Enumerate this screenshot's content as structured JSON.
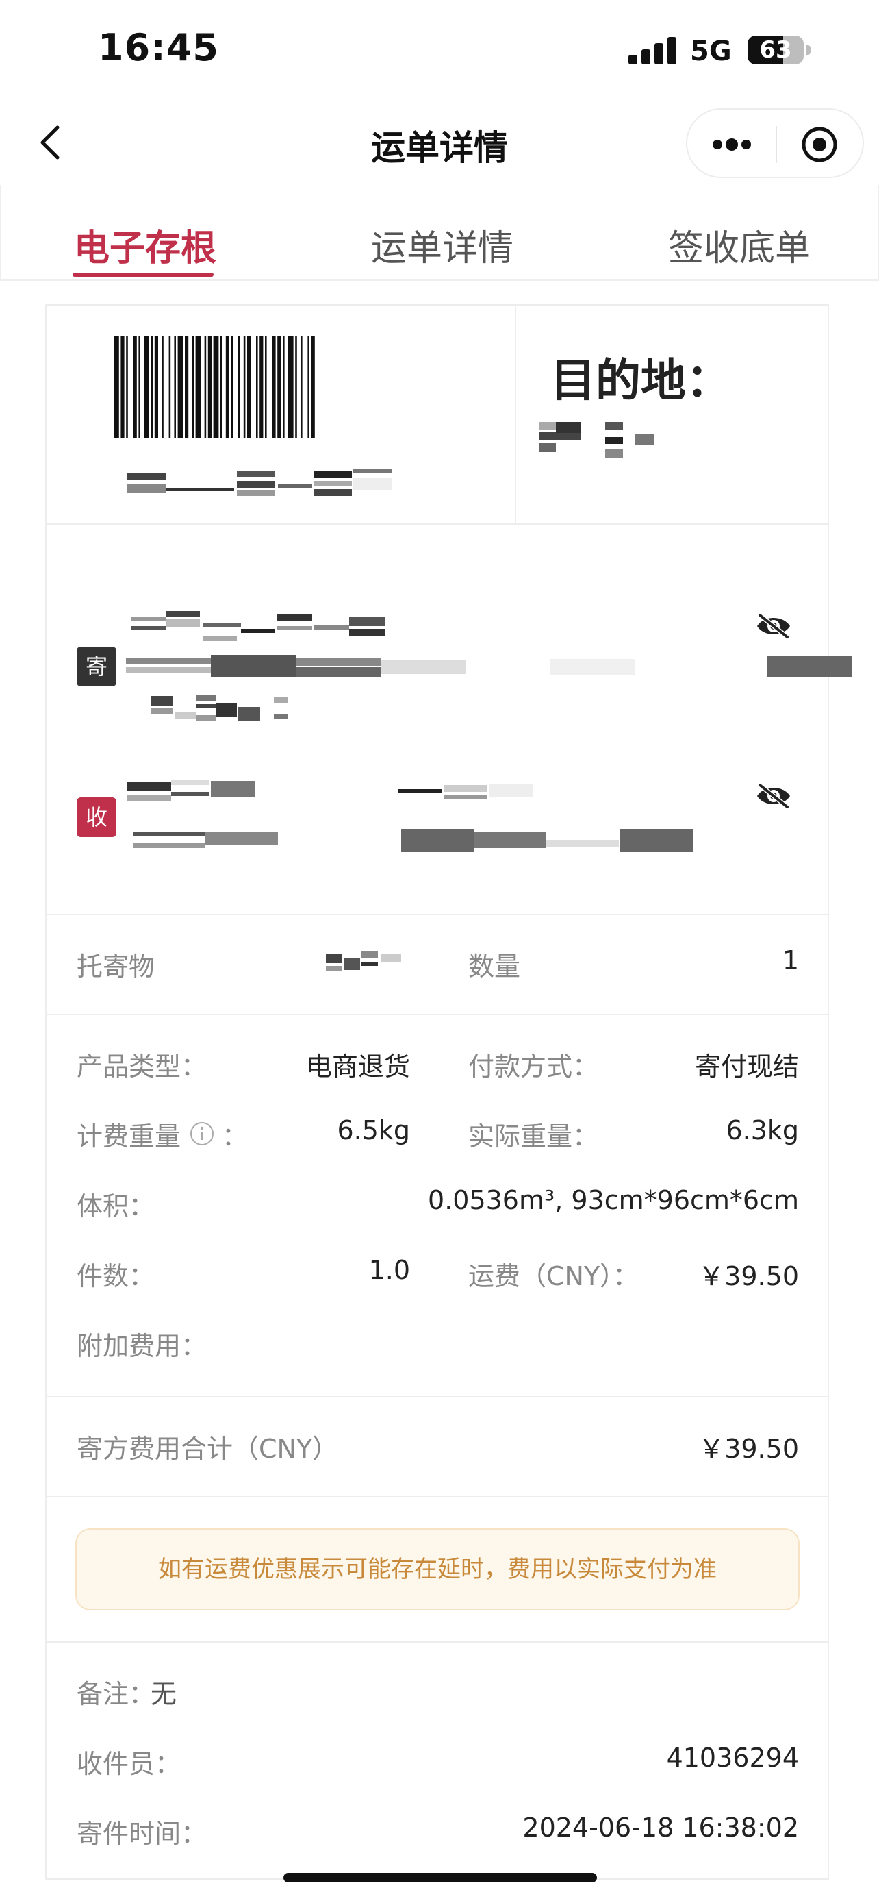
{
  "status_bar": {
    "time": "16:45",
    "network": "5G",
    "battery": "63",
    "battery_level": 0.63
  },
  "nav": {
    "title": "运单详情"
  },
  "tabs": [
    {
      "label": "电子存根",
      "active": true
    },
    {
      "label": "运单详情",
      "active": false
    },
    {
      "label": "签收底单",
      "active": false
    }
  ],
  "waybill": {
    "destination_label": "目的地："
  },
  "parties": {
    "sender_badge": "寄",
    "receiver_badge": "收"
  },
  "goods": {
    "item_label": "托寄物",
    "quantity_label": "数量",
    "quantity_value": "1"
  },
  "details": {
    "product_type_label": "产品类型：",
    "product_type_value": "电商退货",
    "payment_label": "付款方式：",
    "payment_value": "寄付现结",
    "billing_weight_label": "计费重量",
    "billing_weight_colon": "：",
    "billing_weight_value": "6.5kg",
    "actual_weight_label": "实际重量：",
    "actual_weight_value": "6.3kg",
    "volume_label": "体积：",
    "volume_value": "0.0536m³, 93cm*96cm*6cm",
    "pieces_label": "件数：",
    "pieces_value": "1.0",
    "freight_label": "运费（CNY）：",
    "freight_value": "￥39.50",
    "extra_fee_label": "附加费用："
  },
  "total": {
    "label": "寄方费用合计（CNY）",
    "value": "￥39.50"
  },
  "notice": "如有运费优惠展示可能存在延时，费用以实际支付为准",
  "footer": {
    "remark_label": "备注：",
    "remark_value": "无",
    "courier_label": "收件员：",
    "courier_value": "41036294",
    "send_time_label": "寄件时间：",
    "send_time_value": "2024-06-18 16:38:02"
  },
  "colors": {
    "accent": "#c0304a",
    "sender_badge": "#333333",
    "receiver_badge": "#c0304a",
    "notice_text": "#c88a3a",
    "notice_bg": "#fdf7ec"
  },
  "icons": {
    "back": "chevron-left-icon",
    "more": "more-dots-icon",
    "close": "target-circle-icon",
    "privacy": "eye-slash-icon",
    "info": "info-circle-icon"
  }
}
